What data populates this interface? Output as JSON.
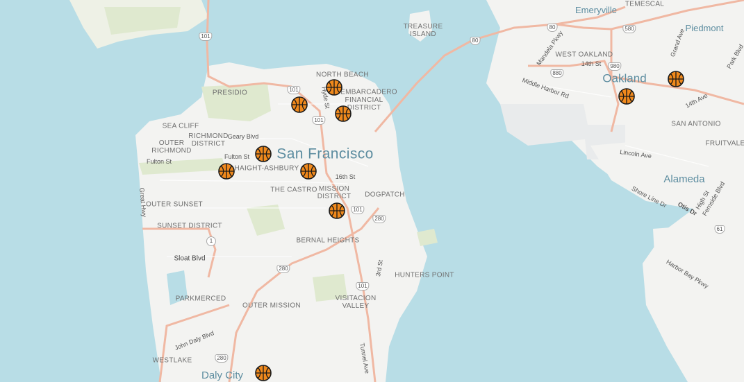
{
  "map": {
    "city_labels": [
      {
        "name": "city-label-san-francisco",
        "text": "San Francisco"
      },
      {
        "name": "city-label-oakland",
        "text": "Oakland"
      },
      {
        "name": "city-label-alameda",
        "text": "Alameda"
      },
      {
        "name": "city-label-daly-city",
        "text": "Daly City"
      },
      {
        "name": "city-label-emeryville",
        "text": "Emeryville"
      },
      {
        "name": "city-label-piedmont",
        "text": "Piedmont"
      }
    ],
    "neighborhoods": [
      {
        "name": "nb-treasure-island",
        "text": "TREASURE\nISLAND"
      },
      {
        "name": "nb-temescal",
        "text": "TEMESCAL"
      },
      {
        "name": "nb-west-oakland",
        "text": "WEST OAKLAND"
      },
      {
        "name": "nb-north-beach",
        "text": "NORTH BEACH"
      },
      {
        "name": "nb-embarcadero",
        "text": "EMBARCADERO"
      },
      {
        "name": "nb-financial-district",
        "text": "FINANCIAL\nDISTRICT"
      },
      {
        "name": "nb-presidio",
        "text": "PRESIDIO"
      },
      {
        "name": "nb-sea-cliff",
        "text": "SEA CLIFF"
      },
      {
        "name": "nb-richmond-district",
        "text": "RICHMOND\nDISTRICT"
      },
      {
        "name": "nb-outer-richmond",
        "text": "OUTER\nRICHMOND"
      },
      {
        "name": "nb-haight-ashbury",
        "text": "HAIGHT-ASHBURY"
      },
      {
        "name": "nb-the-castro",
        "text": "THE CASTRO"
      },
      {
        "name": "nb-mission-district",
        "text": "MISSION\nDISTRICT"
      },
      {
        "name": "nb-dogpatch",
        "text": "DOGPATCH"
      },
      {
        "name": "nb-outer-sunset",
        "text": "OUTER SUNSET"
      },
      {
        "name": "nb-sunset-district",
        "text": "SUNSET DISTRICT"
      },
      {
        "name": "nb-bernal-heights",
        "text": "BERNAL HEIGHTS"
      },
      {
        "name": "nb-hunters-point",
        "text": "HUNTERS POINT"
      },
      {
        "name": "nb-parkmerced",
        "text": "PARKMERCED"
      },
      {
        "name": "nb-outer-mission",
        "text": "OUTER MISSION"
      },
      {
        "name": "nb-visitacion-valley",
        "text": "VISITACION\nVALLEY"
      },
      {
        "name": "nb-westlake",
        "text": "WESTLAKE"
      },
      {
        "name": "nb-san-antonio",
        "text": "SAN ANTONIO"
      },
      {
        "name": "nb-fruitvale",
        "text": "FRUITVALE"
      }
    ],
    "streets": [
      {
        "name": "street-geary-blvd",
        "text": "Geary Blvd"
      },
      {
        "name": "street-fulton-st-west",
        "text": "Fulton St"
      },
      {
        "name": "street-fulton-st-east",
        "text": "Fulton St"
      },
      {
        "name": "street-hyde-st",
        "text": "Hyde St"
      },
      {
        "name": "street-16th-st",
        "text": "16th St"
      },
      {
        "name": "street-great-hwy",
        "text": "Great Hwy"
      },
      {
        "name": "street-sloat-blvd",
        "text": "Sloat Blvd"
      },
      {
        "name": "street-3rd-st",
        "text": "3rd St"
      },
      {
        "name": "street-john-daly-blvd",
        "text": "John Daly Blvd"
      },
      {
        "name": "street-tunnel-ave",
        "text": "Tunnel Ave"
      },
      {
        "name": "street-mandela-pkwy",
        "text": "Mandela Pkwy"
      },
      {
        "name": "street-14th-st",
        "text": "14th St"
      },
      {
        "name": "street-middle-harbor-rd",
        "text": "Middle Harbor Rd"
      },
      {
        "name": "street-grand-ave",
        "text": "Grand Ave"
      },
      {
        "name": "street-park-blvd",
        "text": "Park Blvd"
      },
      {
        "name": "street-14th-ave",
        "text": "14th Ave"
      },
      {
        "name": "street-lincoln-ave",
        "text": "Lincoln Ave"
      },
      {
        "name": "street-shore-line-dr",
        "text": "Shore Line Dr"
      },
      {
        "name": "street-otis-dr",
        "text": "Otis Dr"
      },
      {
        "name": "street-high-st",
        "text": "High St"
      },
      {
        "name": "street-fernside-blvd",
        "text": "Fernside Blvd"
      },
      {
        "name": "street-harbor-bay-pkwy",
        "text": "Harbor Bay Pkwy"
      }
    ],
    "shields": [
      {
        "name": "highway-shield-101-north",
        "text": "101"
      },
      {
        "name": "highway-shield-101-marina",
        "text": "101"
      },
      {
        "name": "highway-shield-101-civic",
        "text": "101"
      },
      {
        "name": "highway-shield-101-mission",
        "text": "101"
      },
      {
        "name": "highway-shield-101-south",
        "text": "101"
      },
      {
        "name": "highway-shield-80-bridge",
        "text": "80"
      },
      {
        "name": "highway-shield-80-emeryville",
        "text": "80"
      },
      {
        "name": "highway-shield-580",
        "text": "580"
      },
      {
        "name": "highway-shield-880",
        "text": "880"
      },
      {
        "name": "highway-shield-980",
        "text": "980"
      },
      {
        "name": "highway-shield-280-dogpatch",
        "text": "280"
      },
      {
        "name": "highway-shield-280-central",
        "text": "280"
      },
      {
        "name": "highway-shield-280-south",
        "text": "280"
      },
      {
        "name": "highway-shield-1",
        "text": "1"
      },
      {
        "name": "highway-shield-61",
        "text": "61"
      }
    ],
    "markers": [
      {
        "name": "basketball-marker-north-beach",
        "icon": "basketball-icon"
      },
      {
        "name": "basketball-marker-russian-hill",
        "icon": "basketball-icon"
      },
      {
        "name": "basketball-marker-financial-district",
        "icon": "basketball-icon"
      },
      {
        "name": "basketball-marker-western-addition",
        "icon": "basketball-icon"
      },
      {
        "name": "basketball-marker-golden-gate-park",
        "icon": "basketball-icon"
      },
      {
        "name": "basketball-marker-duboce",
        "icon": "basketball-icon"
      },
      {
        "name": "basketball-marker-mission",
        "icon": "basketball-icon"
      },
      {
        "name": "basketball-marker-daly-city",
        "icon": "basketball-icon"
      },
      {
        "name": "basketball-marker-oakland-downtown",
        "icon": "basketball-icon"
      },
      {
        "name": "basketball-marker-oakland-lake",
        "icon": "basketball-icon"
      }
    ],
    "colors": {
      "water": "#b8dde6",
      "land": "#f3f3f1",
      "park": "#dfe9cf",
      "highway": "#f0b8a3",
      "marker_fill": "#f0891c",
      "marker_stroke": "#1a1a1a",
      "city_label": "#5d8da0"
    }
  }
}
